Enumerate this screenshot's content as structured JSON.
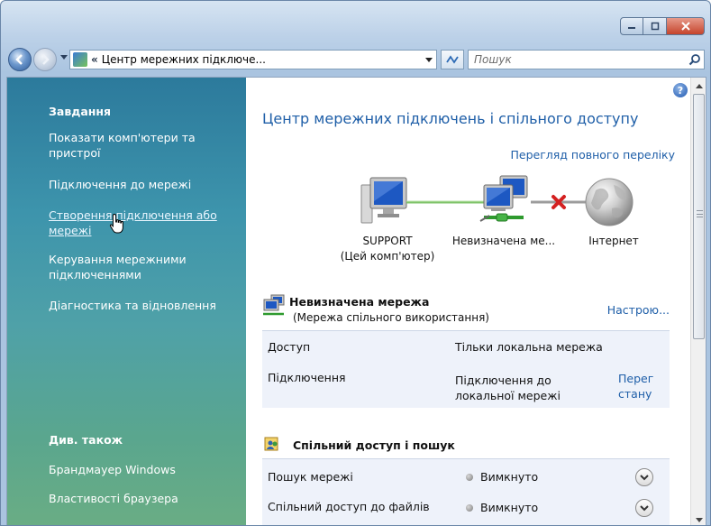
{
  "window": {
    "caption_buttons": {
      "minimize_icon": "minimize-icon",
      "maximize_icon": "maximize-icon",
      "close_icon": "close-icon"
    }
  },
  "navbar": {
    "address_chevron": "«",
    "address_text": "Центр мережних підключе...",
    "search_placeholder": "Пошук"
  },
  "left_pane": {
    "tasks_title": "Завдання",
    "tasks": [
      {
        "label": "Показати комп'ютери та пристрої"
      },
      {
        "label": "Підключення до мережі"
      },
      {
        "label": "Створення підключення або мережі"
      },
      {
        "label": "Керування мережними підключеннями"
      },
      {
        "label": "Діагностика та відновлення"
      }
    ],
    "see_also_title": "Див. також",
    "see_also": [
      {
        "label": "Брандмауер Windows"
      },
      {
        "label": "Властивості браузера"
      }
    ]
  },
  "main": {
    "title": "Центр мережних підключень і спільного доступу",
    "full_map_link": "Перегляд повного переліку",
    "network_map": {
      "computer_name": "SUPPORT",
      "computer_note": "(Цей комп'ютер)",
      "network_label": "Невизначена ме...",
      "internet_label": "Інтернет"
    },
    "network": {
      "name": "Невизначена мережа",
      "type": "(Мережа спільного використання)",
      "customize_link": "Настрою...",
      "rows": [
        {
          "label": "Доступ",
          "value": "Тільки локальна мережа",
          "link": ""
        },
        {
          "label": "Підключення",
          "value_line1": "Підключення до",
          "value_line2": "локальної мережі",
          "link_line1": "Перег",
          "link_line2": "стану"
        }
      ]
    },
    "sharing": {
      "title": "Спільний доступ і пошук",
      "rows": [
        {
          "label": "Пошук мережі",
          "status": "Вимкнуто"
        },
        {
          "label": "Спільний доступ до файлів",
          "status": "Вимкнуто"
        }
      ]
    }
  },
  "colors": {
    "link": "#1e5ea8",
    "title": "#1f5fa8",
    "left_pane_top": "#2c7a9c",
    "left_pane_bottom": "#6aad84",
    "broken_link": "#d42020",
    "connection_line": "#7fc36a"
  }
}
